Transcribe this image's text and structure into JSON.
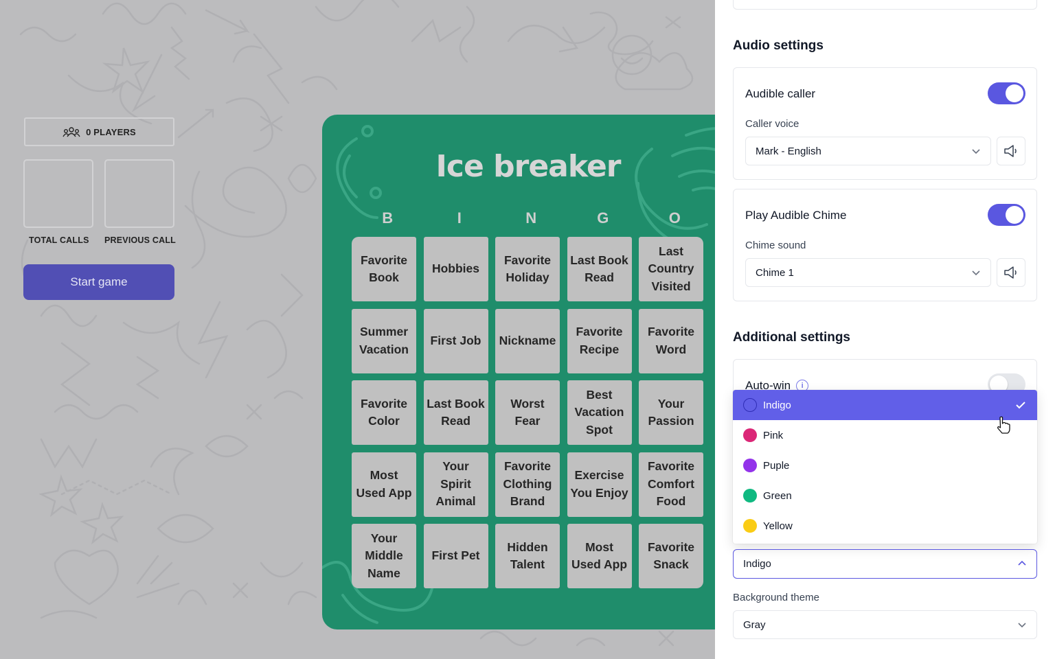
{
  "game": {
    "players_label": "0 PLAYERS",
    "total_calls_label": "TOTAL CALLS",
    "previous_call_label": "PREVIOUS CALL",
    "start_button": "Start game"
  },
  "card": {
    "title": "Ice breaker",
    "letters": [
      "B",
      "I",
      "N",
      "G",
      "O"
    ],
    "cells": [
      "Favorite Book",
      "Hobbies",
      "Favorite Holiday",
      "Last Book Read",
      "Last Country Visited",
      "Summer Vacation",
      "First Job",
      "Nickname",
      "Favorite Recipe",
      "Favorite Word",
      "Favorite Color",
      "Last Book Read",
      "Worst Fear",
      "Best Vacation Spot",
      "Your Passion",
      "Most Used App",
      "Your Spirit Animal",
      "Favorite Clothing Brand",
      "Exercise You Enjoy",
      "Favorite Comfort Food",
      "Your Middle Name",
      "First Pet",
      "Hidden Talent",
      "Most Used App",
      "Favorite Snack"
    ],
    "card_color": "#1f8d6b"
  },
  "settings": {
    "audio": {
      "title": "Audio settings",
      "audible_caller": {
        "label": "Audible caller",
        "enabled": true
      },
      "caller_voice": {
        "label": "Caller voice",
        "value": "Mark - English"
      },
      "audible_chime": {
        "label": "Play Audible Chime",
        "enabled": true
      },
      "chime_sound": {
        "label": "Chime sound",
        "value": "Chime 1"
      }
    },
    "additional": {
      "title": "Additional settings",
      "auto_win": {
        "label": "Auto-win",
        "enabled": false
      },
      "theme_options": [
        {
          "label": "Indigo",
          "color": "#615fe8",
          "selected": true
        },
        {
          "label": "Pink",
          "color": "#db2777",
          "selected": false
        },
        {
          "label": "Puple",
          "color": "#9333ea",
          "selected": false
        },
        {
          "label": "Green",
          "color": "#10b981",
          "selected": false
        },
        {
          "label": "Yellow",
          "color": "#facc15",
          "selected": false
        }
      ],
      "theme_value": "Indigo",
      "background_theme": {
        "label": "Background theme",
        "value": "Gray"
      }
    }
  },
  "colors": {
    "accent": "#5a57e0",
    "start_button": "#514fb4"
  }
}
